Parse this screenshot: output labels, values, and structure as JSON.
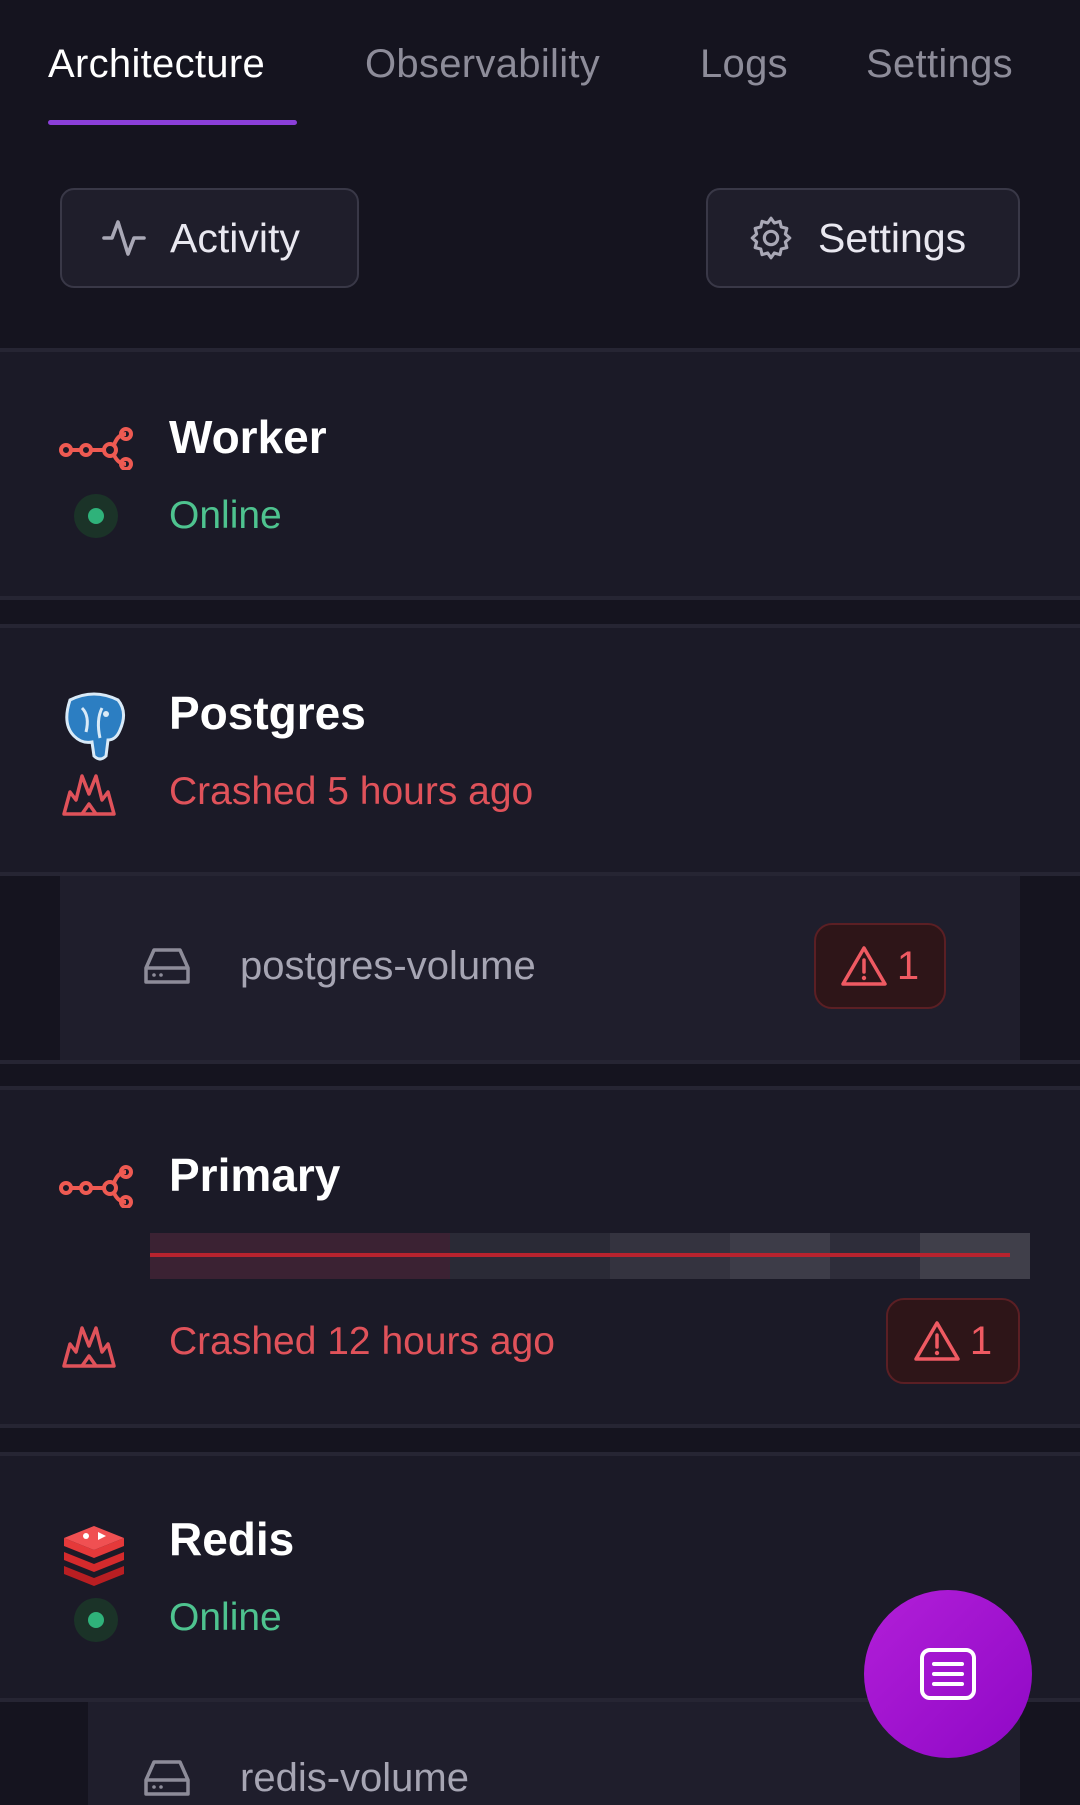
{
  "tabs": [
    {
      "label": "Architecture",
      "active": true
    },
    {
      "label": "Observability",
      "active": false
    },
    {
      "label": "Logs",
      "active": false
    },
    {
      "label": "Settings",
      "active": false
    }
  ],
  "toolbar": {
    "activity_label": "Activity",
    "activity_icon": "activity-pulse-icon",
    "settings_label": "Settings",
    "settings_icon": "gear-icon"
  },
  "services": [
    {
      "name": "Worker",
      "status": "Online",
      "status_type": "online",
      "icon": "service-graph-icon"
    },
    {
      "name": "Postgres",
      "status": "Crashed 5 hours ago",
      "status_type": "crashed",
      "icon": "postgres-elephant-icon",
      "volume": {
        "name": "postgres-volume",
        "alert_count": "1"
      }
    },
    {
      "name": "Primary",
      "status": "Crashed 12 hours ago",
      "status_type": "crashed",
      "icon": "service-graph-icon",
      "alert_count": "1"
    },
    {
      "name": "Redis",
      "status": "Online",
      "status_type": "online",
      "icon": "redis-icon",
      "volume": {
        "name": "redis-volume"
      }
    }
  ],
  "colors": {
    "background": "#15141f",
    "card": "#1b1a27",
    "accent": "#8b3fd9",
    "online": "#4ec38f",
    "crashed": "#e0525a",
    "fab": "#a812d0"
  },
  "fab": {
    "icon": "document-list-icon"
  }
}
